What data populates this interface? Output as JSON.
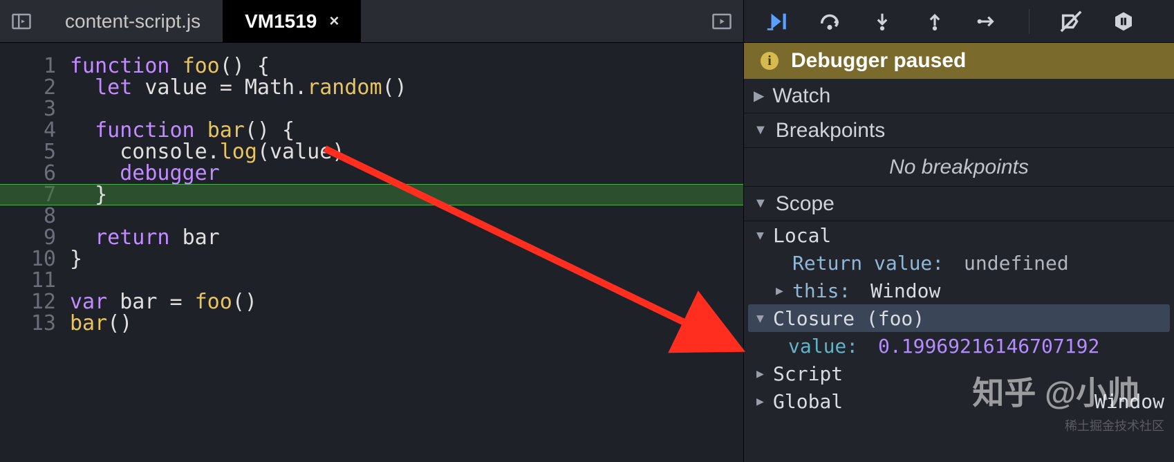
{
  "tabs": {
    "items": [
      {
        "label": "content-script.js",
        "active": false
      },
      {
        "label": "VM1519",
        "active": true
      }
    ],
    "close_glyph": "×"
  },
  "code": {
    "lines": [
      [
        {
          "t": "function ",
          "c": "kw"
        },
        {
          "t": "foo",
          "c": "fn"
        },
        {
          "t": "() {",
          "c": "punc"
        }
      ],
      [
        {
          "t": "  ",
          "c": "punc"
        },
        {
          "t": "let ",
          "c": "kw"
        },
        {
          "t": "value = ",
          "c": "id"
        },
        {
          "t": "Math",
          "c": "id"
        },
        {
          "t": ".",
          "c": "punc"
        },
        {
          "t": "random",
          "c": "fn"
        },
        {
          "t": "()",
          "c": "punc"
        }
      ],
      [],
      [
        {
          "t": "  ",
          "c": "punc"
        },
        {
          "t": "function ",
          "c": "kw"
        },
        {
          "t": "bar",
          "c": "fn"
        },
        {
          "t": "() {",
          "c": "punc"
        }
      ],
      [
        {
          "t": "    console.",
          "c": "id"
        },
        {
          "t": "log",
          "c": "fn"
        },
        {
          "t": "(value)",
          "c": "punc"
        }
      ],
      [
        {
          "t": "    ",
          "c": "punc"
        },
        {
          "t": "debugger",
          "c": "dbg"
        }
      ],
      [
        {
          "t": "  }",
          "c": "punc"
        }
      ],
      [],
      [
        {
          "t": "  ",
          "c": "punc"
        },
        {
          "t": "return ",
          "c": "kw"
        },
        {
          "t": "bar",
          "c": "id"
        }
      ],
      [
        {
          "t": "}",
          "c": "punc"
        }
      ],
      [],
      [
        {
          "t": "var ",
          "c": "kw"
        },
        {
          "t": "bar = ",
          "c": "id"
        },
        {
          "t": "foo",
          "c": "fn"
        },
        {
          "t": "()",
          "c": "punc"
        }
      ],
      [
        {
          "t": "bar",
          "c": "fn"
        },
        {
          "t": "()",
          "c": "punc"
        }
      ]
    ],
    "highlight_line_index": 6
  },
  "debugger": {
    "banner": "Debugger paused",
    "sections": {
      "watch": "Watch",
      "breakpoints": "Breakpoints",
      "no_breakpoints": "No breakpoints",
      "scope": "Scope"
    },
    "scope": {
      "local_label": "Local",
      "return_key": "Return value:",
      "return_val": "undefined",
      "this_key": "this:",
      "this_val": "Window",
      "closure_label": "Closure (foo)",
      "closure_key": "value:",
      "closure_val": "0.19969216146707192",
      "script_label": "Script",
      "global_label": "Global",
      "global_val": "Window"
    }
  },
  "watermarks": {
    "big": "知乎 @小帅",
    "small": "稀土掘金技术社区"
  },
  "colors": {
    "accent_resume": "#5aa0ff",
    "banner_bg": "#7a6a2b"
  }
}
